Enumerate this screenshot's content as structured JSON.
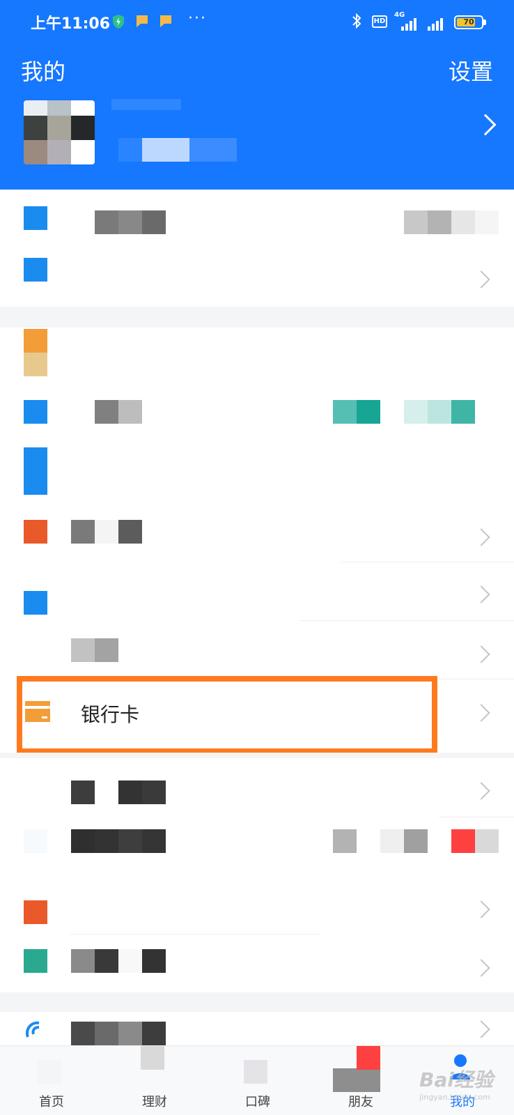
{
  "status_bar": {
    "time": "上午11:06",
    "network": "4G",
    "hd": "HD",
    "battery": "70",
    "overflow": "···"
  },
  "header": {
    "title": "我的",
    "settings_label": "设置"
  },
  "list": {
    "bank_card_label": "银行卡"
  },
  "bottom_nav": {
    "items": [
      {
        "label": "首页"
      },
      {
        "label": "理财"
      },
      {
        "label": "口碑"
      },
      {
        "label": "朋友"
      },
      {
        "label": "我的"
      }
    ],
    "active_index": 4
  },
  "watermark": {
    "brand": "Bai经验",
    "url": "jingyan.baidu.com"
  },
  "colors": {
    "brand_blue": "#1677ff",
    "highlight_orange": "#ff7a1f",
    "bank_icon_orange": "#f29d38"
  }
}
